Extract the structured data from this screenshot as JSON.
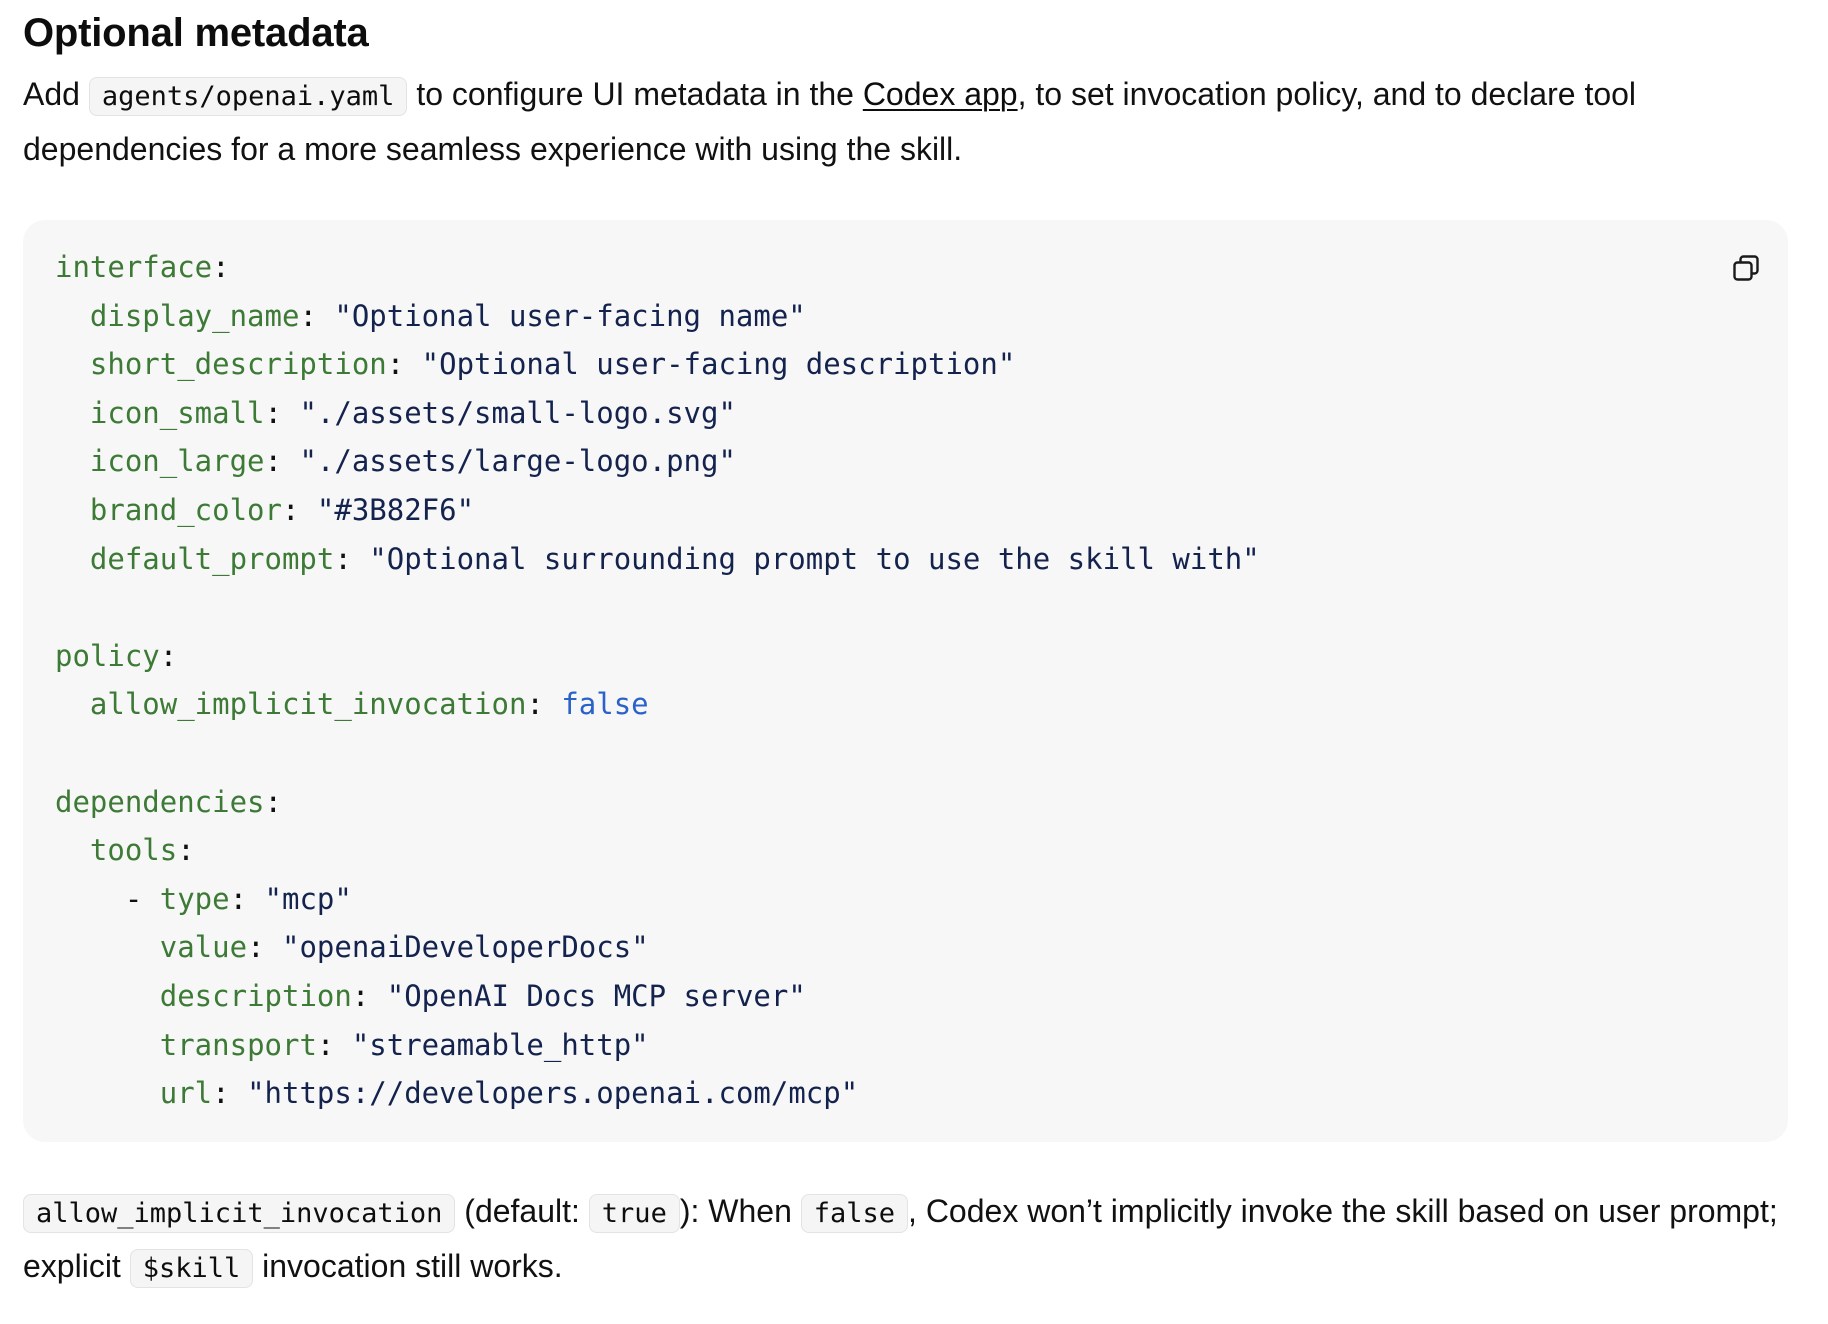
{
  "heading": "Optional metadata",
  "intro": {
    "part1": "Add ",
    "code_file": "agents/openai.yaml",
    "part2": " to configure UI metadata in the ",
    "link_text": "Codex app",
    "part3": ", to set invocation policy, and to declare tool dependencies for a more seamless experience with using the skill."
  },
  "code_block": {
    "copy_icon": "copy-icon",
    "lines": [
      {
        "indent": "",
        "key": "interface",
        "sep": ":",
        "value": "",
        "vtype": "none"
      },
      {
        "indent": "  ",
        "key": "display_name",
        "sep": ": ",
        "value": "\"Optional user-facing name\"",
        "vtype": "string"
      },
      {
        "indent": "  ",
        "key": "short_description",
        "sep": ": ",
        "value": "\"Optional user-facing description\"",
        "vtype": "string"
      },
      {
        "indent": "  ",
        "key": "icon_small",
        "sep": ": ",
        "value": "\"./assets/small-logo.svg\"",
        "vtype": "string"
      },
      {
        "indent": "  ",
        "key": "icon_large",
        "sep": ": ",
        "value": "\"./assets/large-logo.png\"",
        "vtype": "string"
      },
      {
        "indent": "  ",
        "key": "brand_color",
        "sep": ": ",
        "value": "\"#3B82F6\"",
        "vtype": "string"
      },
      {
        "indent": "  ",
        "key": "default_prompt",
        "sep": ": ",
        "value": "\"Optional surrounding prompt to use the skill with\"",
        "vtype": "string"
      },
      {
        "indent": "",
        "key": "",
        "sep": "",
        "value": "",
        "vtype": "none"
      },
      {
        "indent": "",
        "key": "policy",
        "sep": ":",
        "value": "",
        "vtype": "none"
      },
      {
        "indent": "  ",
        "key": "allow_implicit_invocation",
        "sep": ": ",
        "value": "false",
        "vtype": "bool"
      },
      {
        "indent": "",
        "key": "",
        "sep": "",
        "value": "",
        "vtype": "none"
      },
      {
        "indent": "",
        "key": "dependencies",
        "sep": ":",
        "value": "",
        "vtype": "none"
      },
      {
        "indent": "  ",
        "key": "tools",
        "sep": ":",
        "value": "",
        "vtype": "none"
      },
      {
        "indent": "    - ",
        "key": "type",
        "sep": ": ",
        "value": "\"mcp\"",
        "vtype": "string"
      },
      {
        "indent": "      ",
        "key": "value",
        "sep": ": ",
        "value": "\"openaiDeveloperDocs\"",
        "vtype": "string"
      },
      {
        "indent": "      ",
        "key": "description",
        "sep": ": ",
        "value": "\"OpenAI Docs MCP server\"",
        "vtype": "string"
      },
      {
        "indent": "      ",
        "key": "transport",
        "sep": ": ",
        "value": "\"streamable_http\"",
        "vtype": "string"
      },
      {
        "indent": "      ",
        "key": "url",
        "sep": ": ",
        "value": "\"https://developers.openai.com/mcp\"",
        "vtype": "string"
      }
    ]
  },
  "note": {
    "code_setting": "allow_implicit_invocation",
    "part1": " (default: ",
    "code_default": "true",
    "part2": "): When ",
    "code_false": "false",
    "part3": ", Codex won’t implicitly invoke the skill based on user prompt; explicit ",
    "code_skill": "$skill",
    "part4": " invocation still works."
  }
}
